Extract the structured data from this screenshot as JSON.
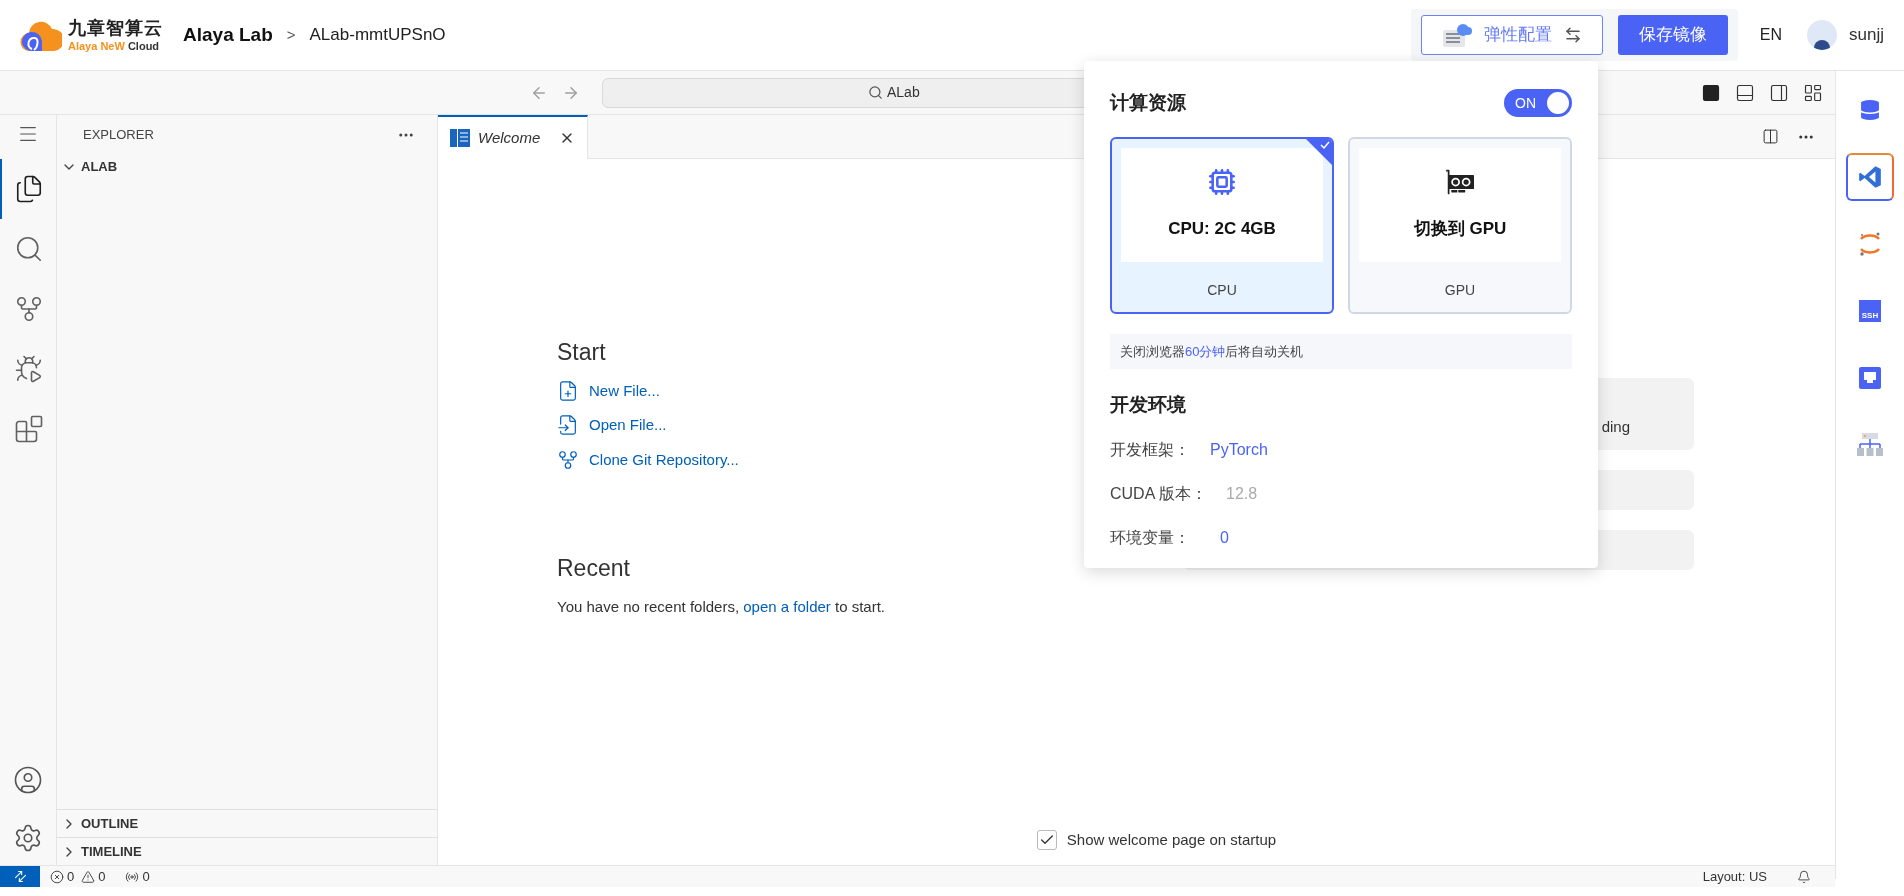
{
  "header": {
    "logo": {
      "name": "九章智算云",
      "subtitle_a": "Alaya NeW",
      "subtitle_b": "Cloud"
    },
    "breadcrumb": [
      "Alaya Lab",
      ">",
      "ALab-mmtUPSnO"
    ],
    "elastic_button": "弹性配置",
    "save_button": "保存镜像",
    "language": "EN",
    "user": "sunjj"
  },
  "title_bar": {
    "search": "ALab"
  },
  "activity": [
    {
      "kind": "explorer",
      "selected": true
    },
    {
      "kind": "search",
      "selected": false
    },
    {
      "kind": "scm",
      "selected": false
    },
    {
      "kind": "debug",
      "selected": false
    },
    {
      "kind": "extensions",
      "selected": false
    }
  ],
  "explorer": {
    "title": "EXPLORER",
    "folder": {
      "label": "ALAB",
      "expanded": true
    },
    "sections": [
      {
        "label": "OUTLINE",
        "expanded": false
      },
      {
        "label": "TIMELINE",
        "expanded": false
      }
    ]
  },
  "tabs": [
    {
      "label": "Welcome",
      "selected": true
    }
  ],
  "welcome": {
    "start_heading": "Start",
    "start_items": [
      {
        "kind": "new",
        "label": "New File..."
      },
      {
        "kind": "open",
        "label": "Open File..."
      },
      {
        "kind": "clone",
        "label": "Clone Git Repository..."
      }
    ],
    "recent_heading": "Recent",
    "recent_before": "You have no recent folders,",
    "recent_link": "open a folder",
    "recent_after": "to start.",
    "walkthrough_fragment": "ding",
    "show_on_startup": {
      "label": "Show welcome page on startup",
      "checked": true
    }
  },
  "popup": {
    "compute_title": "计算资源",
    "toggle": {
      "label": "ON",
      "on": true
    },
    "options": [
      {
        "kind": "cpu",
        "title": "CPU: 2C 4GB",
        "label": "CPU",
        "selected": true
      },
      {
        "kind": "gpu",
        "title": "切换到 GPU",
        "label": "GPU",
        "selected": false
      }
    ],
    "notice_before": "关闭浏览器",
    "notice_highlight": "60分钟",
    "notice_after": "后将自动关机",
    "env_title": "开发环境",
    "env_rows": [
      {
        "label": "开发框架：",
        "value": "PyTorch",
        "kind": "link"
      },
      {
        "label": "CUDA 版本：",
        "value": "12.8",
        "kind": "muted"
      },
      {
        "label": "环境变量：",
        "value": "0",
        "kind": "link"
      }
    ]
  },
  "status_bar": {
    "errors": "0",
    "warnings": "0",
    "ports": "0",
    "layout": "Layout: US"
  },
  "right_tools": [
    {
      "kind": "database",
      "selected": false
    },
    {
      "kind": "vscode",
      "selected": true
    },
    {
      "kind": "jupyter",
      "selected": false
    },
    {
      "kind": "ssh",
      "selected": false,
      "text": "SSH"
    },
    {
      "kind": "port",
      "selected": false
    },
    {
      "kind": "tree",
      "selected": false
    }
  ]
}
